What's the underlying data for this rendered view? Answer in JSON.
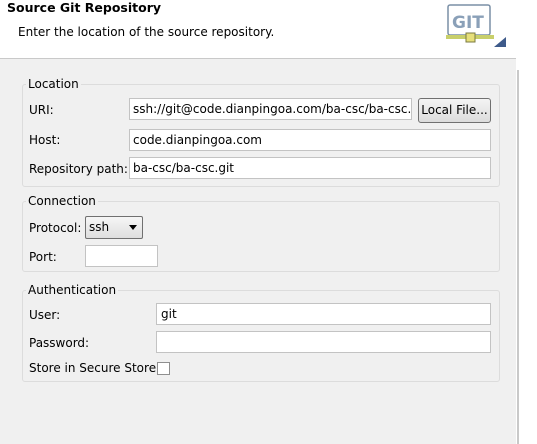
{
  "header": {
    "title": "Source Git Repository",
    "description": "Enter the location of the source repository.",
    "logo_text": "GIT"
  },
  "location": {
    "legend": "Location",
    "uri_label": "URI:",
    "uri_value": "ssh://git@code.dianpingoa.com/ba-csc/ba-csc.git",
    "local_file_label": "Local File...",
    "host_label": "Host:",
    "host_value": "code.dianpingoa.com",
    "repo_path_label": "Repository path:",
    "repo_path_value": "ba-csc/ba-csc.git"
  },
  "connection": {
    "legend": "Connection",
    "protocol_label": "Protocol:",
    "protocol_value": "ssh",
    "port_label": "Port:",
    "port_value": ""
  },
  "authentication": {
    "legend": "Authentication",
    "user_label": "User:",
    "user_value": "git",
    "password_label": "Password:",
    "password_value": "",
    "store_label": "Store in Secure Store",
    "store_checked": false
  }
}
